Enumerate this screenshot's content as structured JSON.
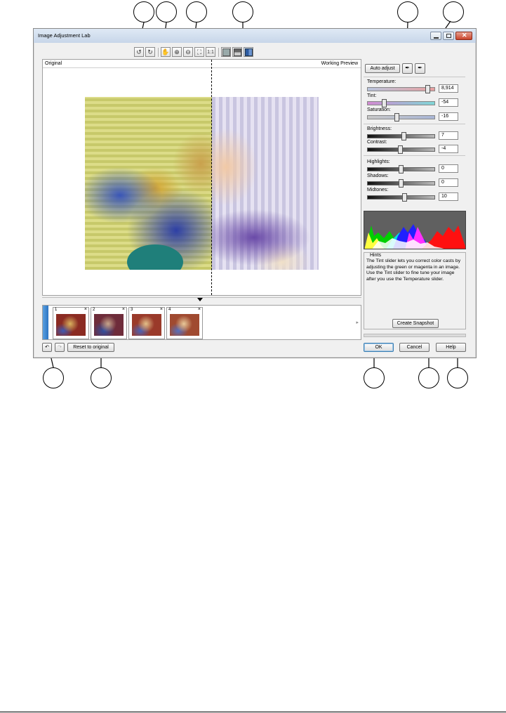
{
  "window": {
    "title": "Image Adjustment Lab",
    "labels": {
      "original": "Original",
      "working_preview": "Working Preview"
    }
  },
  "toolbar": {
    "icons": [
      "rotate-left-icon",
      "rotate-right-icon",
      "hand-pan-icon",
      "zoom-in-icon",
      "zoom-out-icon",
      "zoom-fit-icon",
      "actual-size-icon",
      "full-preview-icon",
      "split-horizontal-icon",
      "split-vertical-icon"
    ]
  },
  "controls": {
    "auto_adjust": "Auto adjust",
    "temperature": {
      "label": "Temperature:",
      "value": "8,914"
    },
    "tint": {
      "label": "Tint:",
      "value": "-54"
    },
    "saturation": {
      "label": "Saturation:",
      "value": "-16"
    },
    "brightness": {
      "label": "Brightness:",
      "value": "7"
    },
    "contrast": {
      "label": "Contrast:",
      "value": "-4"
    },
    "highlights": {
      "label": "Highlights:",
      "value": "0"
    },
    "shadows": {
      "label": "Shadows:",
      "value": "0"
    },
    "midtones": {
      "label": "Midtones:",
      "value": "10"
    }
  },
  "hints": {
    "title": "Hints",
    "text": "The Tint slider lets you correct color casts by adjusting the green or magenta in an image. Use the Tint slider to fine tune your image after you use the Temperature slider."
  },
  "snapshots": {
    "create_label": "Create Snapshot",
    "items": [
      {
        "num": "1"
      },
      {
        "num": "2"
      },
      {
        "num": "3"
      },
      {
        "num": "4"
      }
    ]
  },
  "buttons": {
    "reset": "Reset to original",
    "ok": "OK",
    "cancel": "Cancel",
    "help": "Help"
  },
  "colors": {
    "titlebar": "#c7d6e9",
    "accent": "#3c6fb4"
  }
}
